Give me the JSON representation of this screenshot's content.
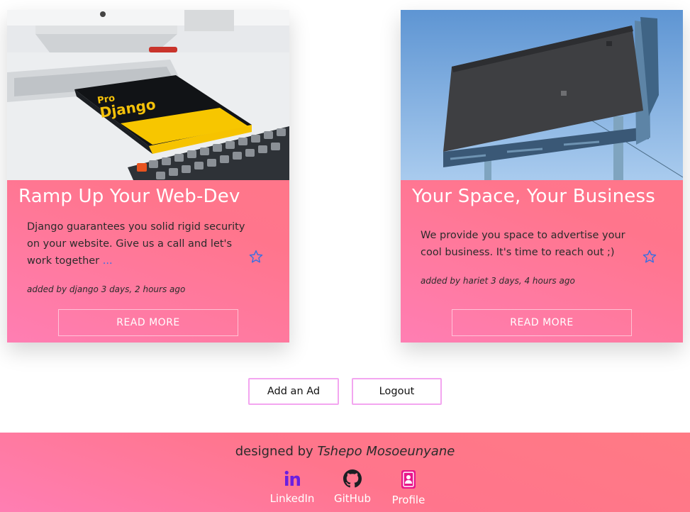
{
  "cards": [
    {
      "title": "Ramp Up Your Web-Dev",
      "description": "Django guarantees you solid rigid security on your website. Give us a call and let's work together",
      "more": "...",
      "meta": "added by django 3 days, 2 hours ago",
      "button": "READ MORE",
      "book_title_small": "Pro",
      "book_title": "Django"
    },
    {
      "title": "Your Space, Your Business",
      "description": "We provide you space to advertise your cool business. It's time to reach out ;)",
      "meta": "added by hariet 3 days, 4 hours ago",
      "button": "READ MORE"
    }
  ],
  "actions": {
    "add_label": "Add an Ad",
    "logout_label": "Logout"
  },
  "footer": {
    "designed_prefix": "designed by",
    "designer": "Tshepo Mosoeunyane",
    "links": [
      {
        "label": "LinkedIn",
        "icon": "linkedin-icon"
      },
      {
        "label": "GitHub",
        "icon": "github-icon"
      },
      {
        "label": "Profile",
        "icon": "profile-icon"
      }
    ]
  },
  "colors": {
    "card_gradient_start": "#ff7eb3",
    "card_gradient_end": "#ff758c",
    "button_border": "#f3a6f0",
    "star": "#3b6fe0",
    "link": "#2f6ee8",
    "linkedin": "#6b1fe0",
    "profile": "#e8158a"
  }
}
